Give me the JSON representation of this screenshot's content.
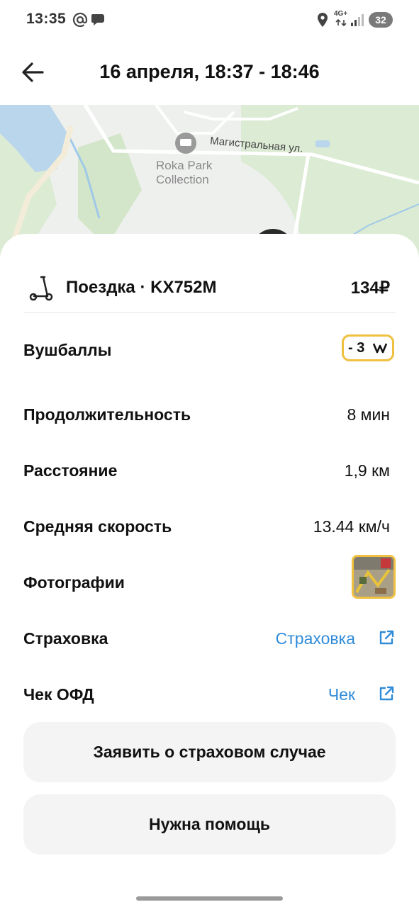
{
  "status_bar": {
    "time": "13:35",
    "network": "4G+",
    "battery": "32"
  },
  "header": {
    "title": "16 апреля, 18:37 - 18:46"
  },
  "map": {
    "street_label": "Магистральная ул.",
    "poi_line1": "Roka Park",
    "poi_line2": "Collection"
  },
  "trip": {
    "label": "Поездка · KX752M",
    "price": "134₽"
  },
  "details": {
    "points": {
      "label": "Вушбаллы",
      "value": "- 3"
    },
    "duration": {
      "label": "Продолжительность",
      "value": "8 мин"
    },
    "distance": {
      "label": "Расстояние",
      "value": "1,9 км"
    },
    "speed": {
      "label": "Средняя скорость",
      "value": "13.44 км/ч"
    },
    "photos": {
      "label": "Фотографии"
    },
    "insurance": {
      "label": "Страховка",
      "link": "Страховка"
    },
    "receipt": {
      "label": "Чек ОФД",
      "link": "Чек"
    }
  },
  "buttons": {
    "claim": "Заявить о страховом случае",
    "help": "Нужна помощь"
  },
  "colors": {
    "accent_link": "#2f8bd8",
    "highlight_border": "#f0c040",
    "button_bg": "#f4f4f4",
    "map_green": "#dcebd3"
  }
}
